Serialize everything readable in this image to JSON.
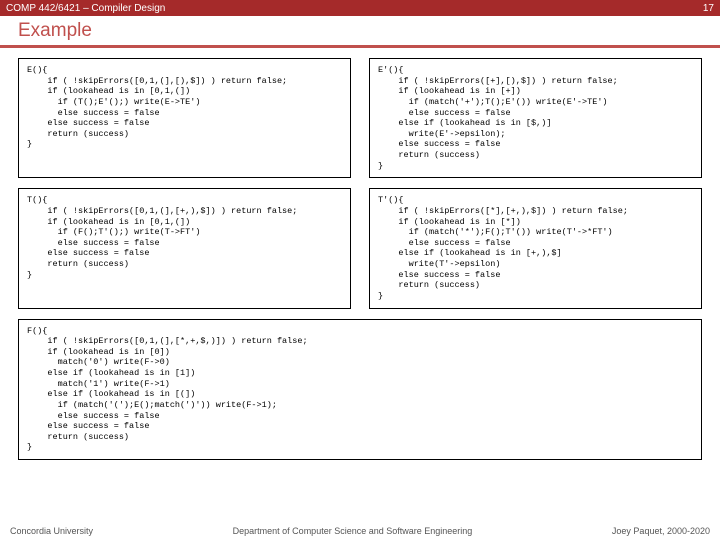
{
  "header": {
    "course": "COMP 442/6421 – Compiler Design",
    "page": "17"
  },
  "title": "Example",
  "code": {
    "e": "E(){\n    if ( !skipErrors([0,1,(],[),$]) ) return false;\n    if (lookahead is in [0,1,(])\n      if (T();E'();) write(E->TE')\n      else success = false\n    else success = false\n    return (success)\n}",
    "ep": "E'(){\n    if ( !skipErrors([+],[),$]) ) return false;\n    if (lookahead is in [+])\n      if (match('+');T();E'()) write(E'->TE')\n      else success = false\n    else if (lookahead is in [$,)]\n      write(E'->epsilon);\n    else success = false\n    return (success)\n}",
    "t": "T(){\n    if ( !skipErrors([0,1,(],[+,),$]) ) return false;\n    if (lookahead is in [0,1,(])\n      if (F();T'();) write(T->FT')\n      else success = false\n    else success = false\n    return (success)\n}",
    "tp": "T'(){\n    if ( !skipErrors([*],[+,),$]) ) return false;\n    if (lookahead is in [*])\n      if (match('*');F();T'()) write(T'->*FT')\n      else success = false\n    else if (lookahead is in [+,),$]\n      write(T'->epsilon)\n    else success = false\n    return (success)\n}",
    "f": "F(){\n    if ( !skipErrors([0,1,(],[*,+,$,)]) ) return false;\n    if (lookahead is in [0])\n      match('0') write(F->0)\n    else if (lookahead is in [1])\n      match('1') write(F->1)\n    else if (lookahead is in [(])\n      if (match('(');E();match(')')) write(F->1);\n      else success = false\n    else success = false\n    return (success)\n}"
  },
  "footer": {
    "left": "Concordia University",
    "center": "Department of Computer Science and Software Engineering",
    "right": "Joey Paquet, 2000-2020"
  }
}
